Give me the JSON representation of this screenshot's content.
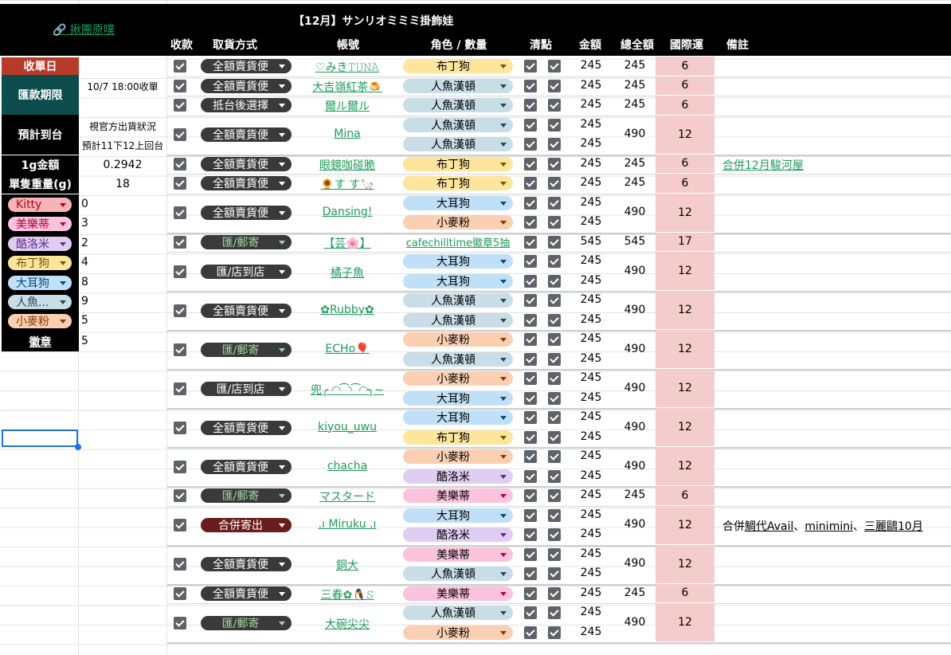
{
  "sheet": {
    "link_label": "揪團原噗",
    "title": "【12月】サンリオミミミ掛飾娃"
  },
  "headers": [
    "收款",
    "取貨方式",
    "帳號",
    "角色 / 數量",
    "清點",
    "金額",
    "總全額",
    "國際運",
    "備註"
  ],
  "left_panel": {
    "close_date_label": "收單日",
    "pay_deadline_label": "匯款期限",
    "close_value": "10/7 18:00收單",
    "eta_label": "預計到台",
    "eta_line1": "視官方出貨狀況",
    "eta_line2": "預計11下12上回台",
    "per_gram_label": "1g金額",
    "per_gram_value": "0.2942",
    "weight_label": "單隻重量(g)",
    "weight_value": "18",
    "badge_label": "徽章",
    "badge_count": "5",
    "chars": [
      {
        "name": "Kitty",
        "count": "0",
        "bg": "#f8b4b4",
        "fg": "#b3001b"
      },
      {
        "name": "美樂蒂",
        "count": "3",
        "bg": "#fbc3dc",
        "fg": "#b3004c"
      },
      {
        "name": "酷洛米",
        "count": "2",
        "bg": "#e0cef2",
        "fg": "#5b2d8c"
      },
      {
        "name": "布丁狗",
        "count": "4",
        "bg": "#fde59c",
        "fg": "#7a5200"
      },
      {
        "name": "大耳狗",
        "count": "8",
        "bg": "#bfe0f6",
        "fg": "#0a4a7a"
      },
      {
        "name": "人魚...",
        "count": "9",
        "bg": "#c8dde6",
        "fg": "#234a5a"
      },
      {
        "name": "小麥粉",
        "count": "5",
        "bg": "#fbcfb1",
        "fg": "#8a3a00"
      }
    ]
  },
  "colors": {
    "布丁狗": {
      "bg": "#fde59c",
      "fg": "#000",
      "tri": "#7a5200"
    },
    "人魚漢頓": {
      "bg": "#c8dde6",
      "fg": "#000",
      "tri": "#234a5a"
    },
    "大耳狗": {
      "bg": "#bfe0f6",
      "fg": "#000",
      "tri": "#0a4a7a"
    },
    "小麥粉": {
      "bg": "#fbcfb1",
      "fg": "#000",
      "tri": "#8a3a00"
    },
    "酷洛米": {
      "bg": "#e0cef2",
      "fg": "#000",
      "tri": "#5b2d8c"
    },
    "美樂蒂": {
      "bg": "#fbc3dc",
      "fg": "#000",
      "tri": "#b3004c"
    },
    "cafechilltime徽章5抽": {
      "bg": "#ffffff",
      "fg": "#1e9b5b",
      "tri": ""
    }
  },
  "methods": {
    "全額賣貨便": {
      "bg": "#3a3a3a",
      "tri": "#ffffff"
    },
    "抵台後選擇": {
      "bg": "#3a3a3a",
      "tri": "#ffffff"
    },
    "匯/郵寄": {
      "bg": "#3a3a3a",
      "tri": "#9fd89f",
      "fg": "#9fd89f"
    },
    "匯/店到店": {
      "bg": "#3a3a3a",
      "tri": "#ffffff"
    },
    "合併寄出": {
      "bg": "#6b1c1c",
      "tri": "#ffffff"
    }
  },
  "orders": [
    {
      "method": "全額賣貨便",
      "account": "♡みき𝚃𝚄𝙽𝙰",
      "items": [
        {
          "role": "布丁狗",
          "amount": "245"
        }
      ],
      "total": "245",
      "intl": "6",
      "note": ""
    },
    {
      "method": "全額賣貨便",
      "account": "大吉嶺紅茶🍮",
      "items": [
        {
          "role": "人魚漢頓",
          "amount": "245"
        }
      ],
      "total": "245",
      "intl": "6",
      "note": ""
    },
    {
      "method": "抵台後選擇",
      "account": "爾ル爾ル",
      "items": [
        {
          "role": "人魚漢頓",
          "amount": "245"
        }
      ],
      "total": "245",
      "intl": "6",
      "note": ""
    },
    {
      "method": "全額賣貨便",
      "account": "Mina",
      "items": [
        {
          "role": "人魚漢頓",
          "amount": "245"
        },
        {
          "role": "人魚漢頓",
          "amount": "245"
        }
      ],
      "total": "490",
      "intl": "12",
      "note": ""
    },
    {
      "method": "全額賣貨便",
      "account": "眼鏡咖碰脆",
      "items": [
        {
          "role": "布丁狗",
          "amount": "245"
        }
      ],
      "total": "245",
      "intl": "6",
      "note": "合併12月駿河屋",
      "note_link": true
    },
    {
      "method": "全額賣貨便",
      "account": "🌻す す🦙",
      "items": [
        {
          "role": "布丁狗",
          "amount": "245"
        }
      ],
      "total": "245",
      "intl": "6",
      "note": ""
    },
    {
      "method": "全額賣貨便",
      "account": "Dansing!",
      "items": [
        {
          "role": "大耳狗",
          "amount": "245"
        },
        {
          "role": "小麥粉",
          "amount": "245"
        }
      ],
      "total": "490",
      "intl": "12",
      "note": ""
    },
    {
      "method": "匯/郵寄",
      "account": "【芸🌸】",
      "items": [
        {
          "role": "cafechilltime徽章5抽",
          "amount": "545"
        }
      ],
      "total": "545",
      "intl": "17",
      "note": ""
    },
    {
      "method": "匯/店到店",
      "account": "橘子魚",
      "items": [
        {
          "role": "大耳狗",
          "amount": "245"
        },
        {
          "role": "大耳狗",
          "amount": "245"
        }
      ],
      "total": "490",
      "intl": "12",
      "note": ""
    },
    {
      "method": "全額賣貨便",
      "account": "✿Rubby✿",
      "items": [
        {
          "role": "人魚漢頓",
          "amount": "245"
        },
        {
          "role": "人魚漢頓",
          "amount": "245"
        }
      ],
      "total": "490",
      "intl": "12",
      "note": ""
    },
    {
      "method": "匯/郵寄",
      "account": "ECHo🎈",
      "items": [
        {
          "role": "小麥粉",
          "amount": "245"
        },
        {
          "role": "人魚漢頓",
          "amount": "245"
        }
      ],
      "total": "490",
      "intl": "12",
      "note": ""
    },
    {
      "method": "匯/店到店",
      "account": "兜╭ ◜◝ ͡ ◝ ͡ ◜◝╮~",
      "items": [
        {
          "role": "小麥粉",
          "amount": "245"
        },
        {
          "role": "大耳狗",
          "amount": "245"
        }
      ],
      "total": "490",
      "intl": "12",
      "note": ""
    },
    {
      "method": "全額賣貨便",
      "account": "kiyou_uwu",
      "items": [
        {
          "role": "大耳狗",
          "amount": "245"
        },
        {
          "role": "布丁狗",
          "amount": "245"
        }
      ],
      "total": "490",
      "intl": "12",
      "note": ""
    },
    {
      "method": "全額賣貨便",
      "account": "chacha",
      "items": [
        {
          "role": "小麥粉",
          "amount": "245"
        },
        {
          "role": "酷洛米",
          "amount": "245"
        }
      ],
      "total": "490",
      "intl": "12",
      "note": ""
    },
    {
      "method": "匯/郵寄",
      "account": "マスタード",
      "items": [
        {
          "role": "美樂蒂",
          "amount": "245"
        }
      ],
      "total": "245",
      "intl": "6",
      "note": ""
    },
    {
      "method": "合併寄出",
      "account": ".ı Miruku .ı",
      "items": [
        {
          "role": "大耳狗",
          "amount": "245"
        },
        {
          "role": "酷洛米",
          "amount": "245"
        }
      ],
      "total": "490",
      "intl": "12",
      "note": "合併鯛代Avail、minimini、三麗鷗10月",
      "note_parts": [
        "合併",
        "鯛代Avail",
        "、",
        "minimini",
        "、",
        "三麗鷗10月"
      ]
    },
    {
      "method": "全額賣貨便",
      "account": "銅大",
      "items": [
        {
          "role": "美樂蒂",
          "amount": "245"
        },
        {
          "role": "人魚漢頓",
          "amount": "245"
        }
      ],
      "total": "490",
      "intl": "12",
      "note": ""
    },
    {
      "method": "全額賣貨便",
      "account": "三春✿🐧𝚂",
      "items": [
        {
          "role": "美樂蒂",
          "amount": "245"
        }
      ],
      "total": "245",
      "intl": "6",
      "note": ""
    },
    {
      "method": "匯/郵寄",
      "account": "大碗尖尖",
      "items": [
        {
          "role": "人魚漢頓",
          "amount": "245"
        },
        {
          "role": "小麥粉",
          "amount": "245"
        }
      ],
      "total": "490",
      "intl": "12",
      "note": ""
    }
  ]
}
